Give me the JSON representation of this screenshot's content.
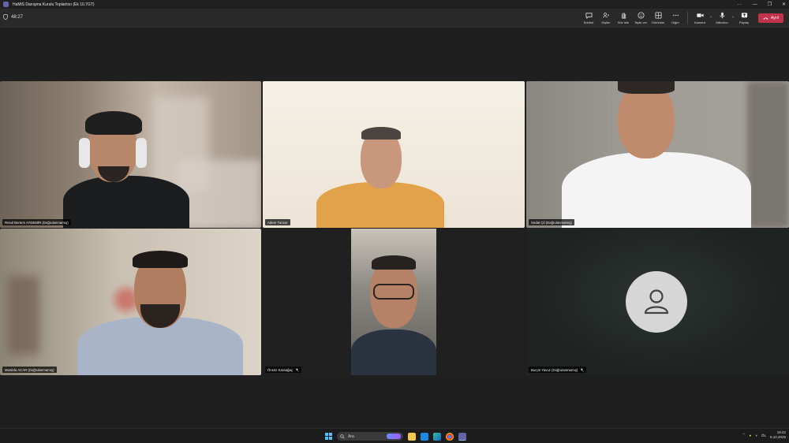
{
  "window": {
    "title": "HaMiS Danışma Kurulu Toplantısı (Ek 10.7GT)",
    "controls": [
      "···",
      "—",
      "❐",
      "✕"
    ]
  },
  "toolbar": {
    "timer": "48:27",
    "buttons": [
      {
        "id": "sohbet",
        "label": "Sohbet",
        "icon": "chat-icon"
      },
      {
        "id": "kisiler",
        "label": "Kişiler",
        "icon": "people-icon",
        "count": "6"
      },
      {
        "id": "elkaldir",
        "label": "Söz iste",
        "icon": "raise-hand-icon"
      },
      {
        "id": "tepki",
        "label": "Tepki ver",
        "icon": "emoji-icon"
      },
      {
        "id": "gorunum",
        "label": "Görünüm",
        "icon": "view-icon"
      },
      {
        "id": "diger",
        "label": "Diğer",
        "icon": "more-icon"
      }
    ],
    "media": [
      {
        "id": "kamera",
        "label": "Kamera",
        "icon": "camera-icon"
      },
      {
        "id": "mikrofon",
        "label": "Mikrofon",
        "icon": "microphone-icon"
      },
      {
        "id": "paylas",
        "label": "Paylaş",
        "icon": "share-icon"
      }
    ],
    "leave_label": "Ayrıl"
  },
  "participants": [
    {
      "name": "Resul Bertem AYDEMİR (Doğrulanmamış)",
      "video": true,
      "muted": false
    },
    {
      "name": "Adem Tuncer",
      "video": true,
      "muted": false
    },
    {
      "name": "Sedat Çil (Doğrulanmamış)",
      "video": true,
      "muted": false
    },
    {
      "name": "Mustafa ACAR (Doğrulanmamış)",
      "video": true,
      "muted": false
    },
    {
      "name": "Önsöz Karaağaç",
      "video": true,
      "muted": true
    },
    {
      "name": "Burçin Yavuz (Doğrulanmamış)",
      "video": false,
      "muted": true
    }
  ],
  "taskbar": {
    "search_placeholder": "Ara",
    "tray_lang": "ÖL",
    "time": "19:42",
    "date": "6.10.2025"
  },
  "colors": {
    "leave": "#c4314b",
    "accent": "#6264a7",
    "background": "#1f1f1f"
  }
}
